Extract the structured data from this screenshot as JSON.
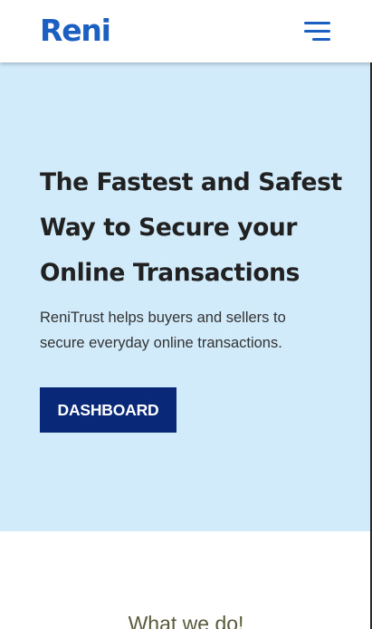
{
  "header": {
    "logo_text": "Reni",
    "menu_icon": "hamburger-menu-icon"
  },
  "hero": {
    "title": "The Fastest and Safest Way to Secure your Online Transactions",
    "subtitle": "ReniTrust helps buyers and sellers to secure everyday online transactions.",
    "button_label": "DASHBOARD"
  },
  "section": {
    "heading": "What we do!"
  },
  "colors": {
    "brand": "#1a5fc1",
    "hero_background": "#d2ebfb",
    "button_background": "#0a2878",
    "heading_text": "#212121"
  }
}
